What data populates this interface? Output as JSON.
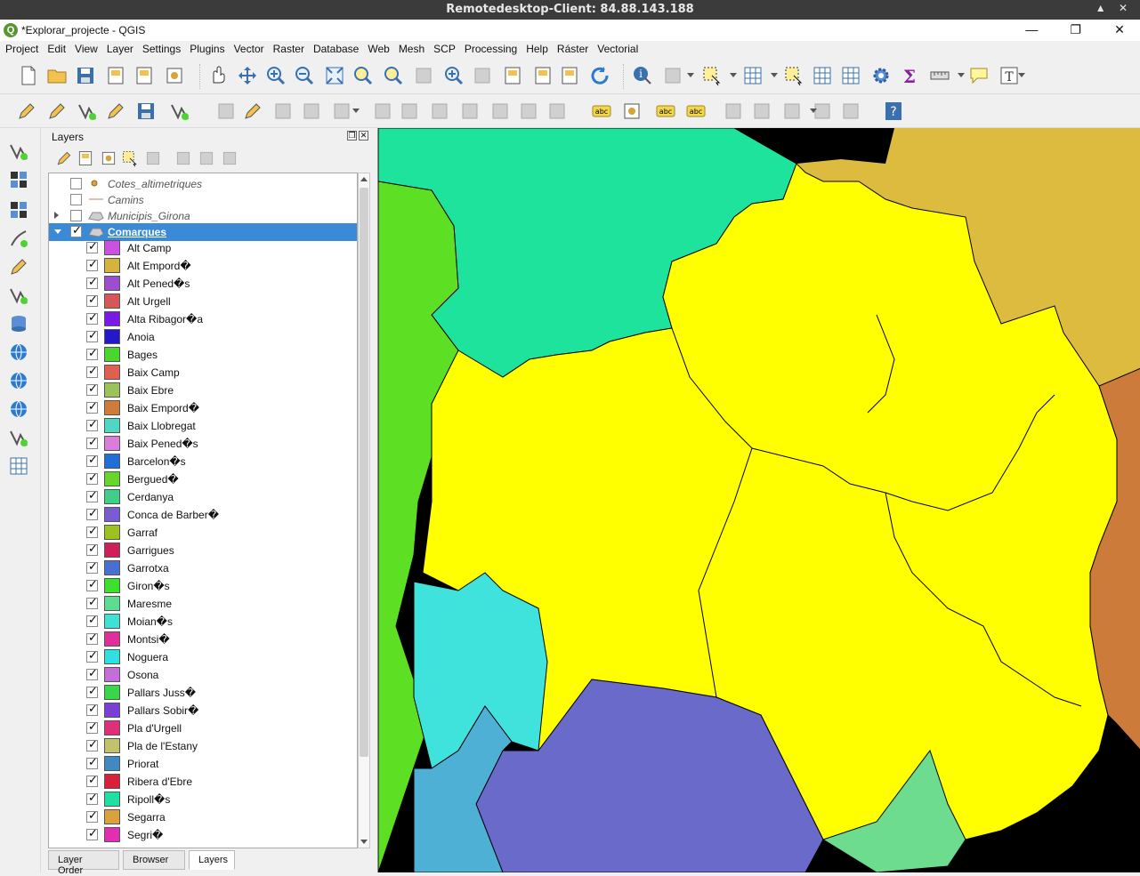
{
  "remote_desktop": {
    "title": "Remotedesktop-Client: 84.88.143.188"
  },
  "window": {
    "title": "*Explorar_projecte - QGIS"
  },
  "menu": [
    "Project",
    "Edit",
    "View",
    "Layer",
    "Settings",
    "Plugins",
    "Vector",
    "Raster",
    "Database",
    "Web",
    "Mesh",
    "SCP",
    "Processing",
    "Help",
    "Ráster",
    "Vectorial"
  ],
  "layers_panel": {
    "title": "Layers",
    "top_layers": [
      {
        "name": "Cotes_altimetriques",
        "checked": false,
        "icon": "point-layer-icon"
      },
      {
        "name": "Camins",
        "checked": false,
        "icon": "line-layer-icon"
      },
      {
        "name": "Municipis_Girona",
        "checked": false,
        "icon": "polygon-layer-icon"
      },
      {
        "name": "Comarques",
        "checked": true,
        "icon": "polygon-layer-icon",
        "selected": true
      }
    ],
    "categories": [
      {
        "label": "Alt Camp",
        "color": "#cb52e0"
      },
      {
        "label": "Alt Empord�",
        "color": "#d6b23f"
      },
      {
        "label": "Alt Pened�s",
        "color": "#9b4fcf"
      },
      {
        "label": "Alt Urgell",
        "color": "#d65757"
      },
      {
        "label": "Alta Ribagor�a",
        "color": "#7a19e6"
      },
      {
        "label": "Anoia",
        "color": "#2418c9"
      },
      {
        "label": "Bages",
        "color": "#4ad62f"
      },
      {
        "label": "Baix Camp",
        "color": "#e0604f"
      },
      {
        "label": "Baix Ebre",
        "color": "#9cc25a"
      },
      {
        "label": "Baix Empord�",
        "color": "#cf7c3a"
      },
      {
        "label": "Baix Llobregat",
        "color": "#4fd6c4"
      },
      {
        "label": "Baix Pened�s",
        "color": "#d97fd9"
      },
      {
        "label": "Barcelon�s",
        "color": "#1f6fd6"
      },
      {
        "label": "Bergued�",
        "color": "#67d62b"
      },
      {
        "label": "Cerdanya",
        "color": "#3fcf8a"
      },
      {
        "label": "Conca de Barber�",
        "color": "#7a5bd1"
      },
      {
        "label": "Garraf",
        "color": "#9cc21f"
      },
      {
        "label": "Garrigues",
        "color": "#cf1f5a"
      },
      {
        "label": "Garrotxa",
        "color": "#4a6fd0"
      },
      {
        "label": "Giron�s",
        "color": "#3de02c"
      },
      {
        "label": "Maresme",
        "color": "#5fdc93"
      },
      {
        "label": "Moian�s",
        "color": "#3fe0d5"
      },
      {
        "label": "Montsi�",
        "color": "#e02f9b"
      },
      {
        "label": "Noguera",
        "color": "#2fe0e0"
      },
      {
        "label": "Osona",
        "color": "#c46fd9"
      },
      {
        "label": "Pallars Juss�",
        "color": "#3ad64a"
      },
      {
        "label": "Pallars Sobir�",
        "color": "#7a3fd6"
      },
      {
        "label": "Pla d'Urgell",
        "color": "#e02f7a"
      },
      {
        "label": "Pla de l'Estany",
        "color": "#c2c26a"
      },
      {
        "label": "Priorat",
        "color": "#3f8ac4"
      },
      {
        "label": "Ribera d'Ebre",
        "color": "#d9203a"
      },
      {
        "label": "Ripoll�s",
        "color": "#1fe0a0"
      },
      {
        "label": "Segarra",
        "color": "#d9a23a"
      },
      {
        "label": "Segri�",
        "color": "#e02fb2"
      }
    ],
    "tabs": [
      "Layer Order",
      "Browser",
      "Layers"
    ],
    "active_tab": "Layers"
  },
  "map_colors": {
    "background": "#000000",
    "yellow": "#ffff00",
    "teal": "#1de39c",
    "lime": "#5de023",
    "ochre": "#dcbb3e",
    "orange": "#cd7b3a",
    "cyan": "#3fe3dc",
    "purple": "#6a6acb",
    "blue_left": "#4fb0d6",
    "green_bottom": "#6ddc8f"
  }
}
